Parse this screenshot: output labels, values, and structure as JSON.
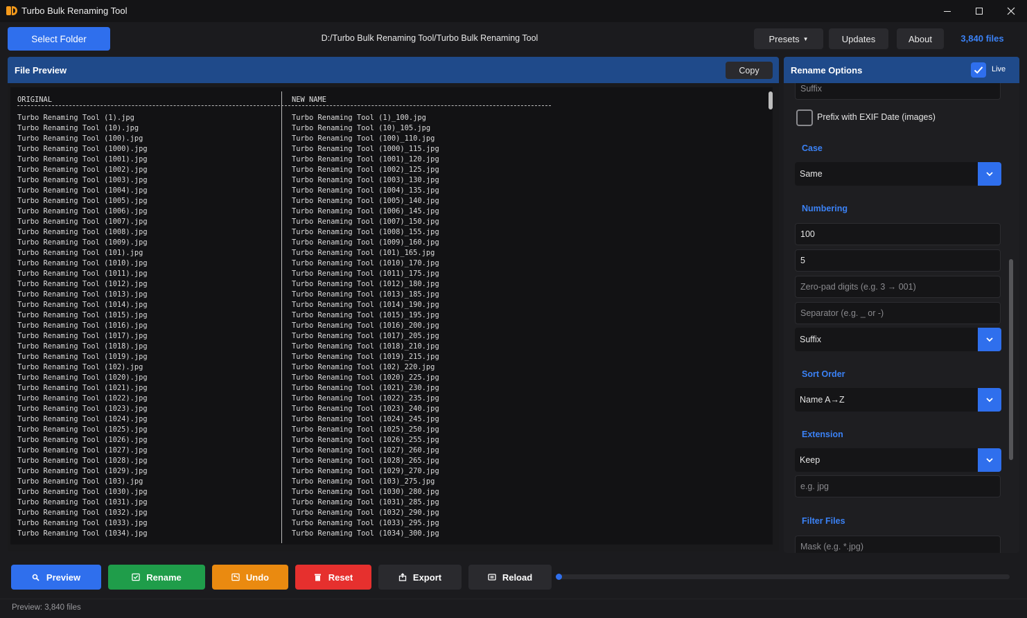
{
  "window": {
    "title": "Turbo Bulk Renaming Tool"
  },
  "toolbar": {
    "select_folder_label": "Select Folder",
    "folder_path": "D:/Turbo Bulk Renaming Tool/Turbo Bulk Renaming Tool",
    "presets_label": "Presets",
    "updates_label": "Updates",
    "about_label": "About",
    "file_count": "3,840 files"
  },
  "preview": {
    "title": "File Preview",
    "copy_label": "Copy",
    "col_original": "ORIGINAL",
    "col_new": "NEW NAME",
    "rows": [
      {
        "original": "Turbo Renaming Tool (1).jpg",
        "new": "Turbo Renaming Tool (1)_100.jpg"
      },
      {
        "original": "Turbo Renaming Tool (10).jpg",
        "new": "Turbo Renaming Tool (10)_105.jpg"
      },
      {
        "original": "Turbo Renaming Tool (100).jpg",
        "new": "Turbo Renaming Tool (100)_110.jpg"
      },
      {
        "original": "Turbo Renaming Tool (1000).jpg",
        "new": "Turbo Renaming Tool (1000)_115.jpg"
      },
      {
        "original": "Turbo Renaming Tool (1001).jpg",
        "new": "Turbo Renaming Tool (1001)_120.jpg"
      },
      {
        "original": "Turbo Renaming Tool (1002).jpg",
        "new": "Turbo Renaming Tool (1002)_125.jpg"
      },
      {
        "original": "Turbo Renaming Tool (1003).jpg",
        "new": "Turbo Renaming Tool (1003)_130.jpg"
      },
      {
        "original": "Turbo Renaming Tool (1004).jpg",
        "new": "Turbo Renaming Tool (1004)_135.jpg"
      },
      {
        "original": "Turbo Renaming Tool (1005).jpg",
        "new": "Turbo Renaming Tool (1005)_140.jpg"
      },
      {
        "original": "Turbo Renaming Tool (1006).jpg",
        "new": "Turbo Renaming Tool (1006)_145.jpg"
      },
      {
        "original": "Turbo Renaming Tool (1007).jpg",
        "new": "Turbo Renaming Tool (1007)_150.jpg"
      },
      {
        "original": "Turbo Renaming Tool (1008).jpg",
        "new": "Turbo Renaming Tool (1008)_155.jpg"
      },
      {
        "original": "Turbo Renaming Tool (1009).jpg",
        "new": "Turbo Renaming Tool (1009)_160.jpg"
      },
      {
        "original": "Turbo Renaming Tool (101).jpg",
        "new": "Turbo Renaming Tool (101)_165.jpg"
      },
      {
        "original": "Turbo Renaming Tool (1010).jpg",
        "new": "Turbo Renaming Tool (1010)_170.jpg"
      },
      {
        "original": "Turbo Renaming Tool (1011).jpg",
        "new": "Turbo Renaming Tool (1011)_175.jpg"
      },
      {
        "original": "Turbo Renaming Tool (1012).jpg",
        "new": "Turbo Renaming Tool (1012)_180.jpg"
      },
      {
        "original": "Turbo Renaming Tool (1013).jpg",
        "new": "Turbo Renaming Tool (1013)_185.jpg"
      },
      {
        "original": "Turbo Renaming Tool (1014).jpg",
        "new": "Turbo Renaming Tool (1014)_190.jpg"
      },
      {
        "original": "Turbo Renaming Tool (1015).jpg",
        "new": "Turbo Renaming Tool (1015)_195.jpg"
      },
      {
        "original": "Turbo Renaming Tool (1016).jpg",
        "new": "Turbo Renaming Tool (1016)_200.jpg"
      },
      {
        "original": "Turbo Renaming Tool (1017).jpg",
        "new": "Turbo Renaming Tool (1017)_205.jpg"
      },
      {
        "original": "Turbo Renaming Tool (1018).jpg",
        "new": "Turbo Renaming Tool (1018)_210.jpg"
      },
      {
        "original": "Turbo Renaming Tool (1019).jpg",
        "new": "Turbo Renaming Tool (1019)_215.jpg"
      },
      {
        "original": "Turbo Renaming Tool (102).jpg",
        "new": "Turbo Renaming Tool (102)_220.jpg"
      },
      {
        "original": "Turbo Renaming Tool (1020).jpg",
        "new": "Turbo Renaming Tool (1020)_225.jpg"
      },
      {
        "original": "Turbo Renaming Tool (1021).jpg",
        "new": "Turbo Renaming Tool (1021)_230.jpg"
      },
      {
        "original": "Turbo Renaming Tool (1022).jpg",
        "new": "Turbo Renaming Tool (1022)_235.jpg"
      },
      {
        "original": "Turbo Renaming Tool (1023).jpg",
        "new": "Turbo Renaming Tool (1023)_240.jpg"
      },
      {
        "original": "Turbo Renaming Tool (1024).jpg",
        "new": "Turbo Renaming Tool (1024)_245.jpg"
      },
      {
        "original": "Turbo Renaming Tool (1025).jpg",
        "new": "Turbo Renaming Tool (1025)_250.jpg"
      },
      {
        "original": "Turbo Renaming Tool (1026).jpg",
        "new": "Turbo Renaming Tool (1026)_255.jpg"
      },
      {
        "original": "Turbo Renaming Tool (1027).jpg",
        "new": "Turbo Renaming Tool (1027)_260.jpg"
      },
      {
        "original": "Turbo Renaming Tool (1028).jpg",
        "new": "Turbo Renaming Tool (1028)_265.jpg"
      },
      {
        "original": "Turbo Renaming Tool (1029).jpg",
        "new": "Turbo Renaming Tool (1029)_270.jpg"
      },
      {
        "original": "Turbo Renaming Tool (103).jpg",
        "new": "Turbo Renaming Tool (103)_275.jpg"
      },
      {
        "original": "Turbo Renaming Tool (1030).jpg",
        "new": "Turbo Renaming Tool (1030)_280.jpg"
      },
      {
        "original": "Turbo Renaming Tool (1031).jpg",
        "new": "Turbo Renaming Tool (1031)_285.jpg"
      },
      {
        "original": "Turbo Renaming Tool (1032).jpg",
        "new": "Turbo Renaming Tool (1032)_290.jpg"
      },
      {
        "original": "Turbo Renaming Tool (1033).jpg",
        "new": "Turbo Renaming Tool (1033)_295.jpg"
      },
      {
        "original": "Turbo Renaming Tool (1034).jpg",
        "new": "Turbo Renaming Tool (1034)_300.jpg"
      }
    ]
  },
  "options": {
    "title": "Rename Options",
    "live_label": "Live",
    "live_checked": true,
    "suffix_placeholder": "Suffix",
    "exif_label": "Prefix with EXIF Date (images)",
    "case_label": "Case",
    "case_value": "Same",
    "numbering_label": "Numbering",
    "numbering_start": "100",
    "numbering_step": "5",
    "zero_pad_placeholder": "Zero-pad digits (e.g. 3 → 001)",
    "separator_placeholder": "Separator (e.g. _ or -)",
    "position_value": "Suffix",
    "sort_label": "Sort Order",
    "sort_value": "Name A→Z",
    "extension_label": "Extension",
    "extension_value": "Keep",
    "extension_placeholder": "e.g. jpg",
    "filter_label": "Filter Files",
    "mask_placeholder": "Mask (e.g. *.jpg)"
  },
  "actions": {
    "preview_label": "Preview",
    "rename_label": "Rename",
    "undo_label": "Undo",
    "reset_label": "Reset",
    "export_label": "Export",
    "reload_label": "Reload",
    "progress_fraction": 0.0
  },
  "status": {
    "text": "Preview: 3,840 files"
  },
  "colors": {
    "accent": "#2f6fed",
    "header": "#1f4a8a",
    "rename": "#1f9d4a",
    "undo": "#ea8a10",
    "reset": "#e6302e"
  }
}
